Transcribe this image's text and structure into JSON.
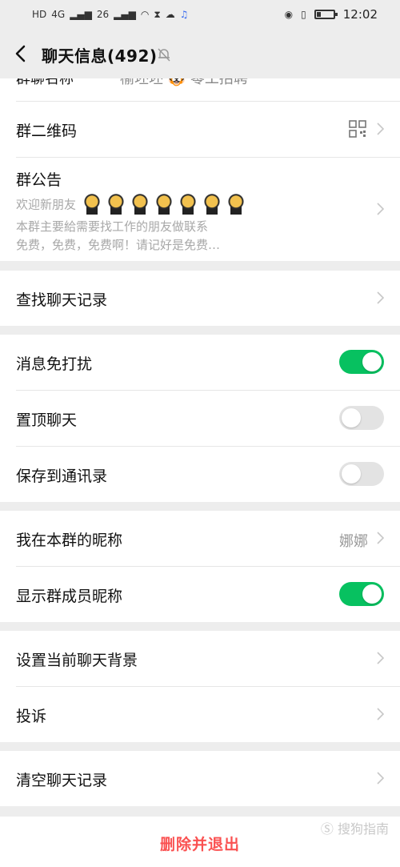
{
  "status_bar": {
    "left_items": [
      "HD",
      "4G",
      "26",
      "wifi",
      "sync",
      "cloud",
      "music"
    ],
    "time": "12:02",
    "battery_level": 0.3
  },
  "nav": {
    "title": "聊天信息(492)"
  },
  "peek": {
    "label": "群聊名称",
    "value": "榆坯坯 🐯 零工招聘"
  },
  "rows": {
    "qrcode": "群二维码",
    "notice_title": "群公告",
    "notice_line1": "欢迎新朋友",
    "notice_line2": "本群主要給需要找工作的朋友做联系",
    "notice_line3": "免费，免费，免费啊！请记好是免费…",
    "search_history": "查找聊天记录",
    "mute": "消息免打扰",
    "pin": "置顶聊天",
    "save_contacts": "保存到通讯录",
    "my_nickname": "我在本群的昵称",
    "my_nickname_value": "娜娜",
    "show_nicknames": "显示群成员昵称",
    "set_background": "设置当前聊天背景",
    "complain": "投诉",
    "clear_history": "清空聊天记录"
  },
  "toggles": {
    "mute": true,
    "pin": false,
    "save_contacts": false,
    "show_nicknames": true
  },
  "footer": {
    "delete_exit": "删除并退出",
    "watermark": "Ⓢ 搜狗指南"
  },
  "colors": {
    "accent_green": "#07c160",
    "danger_red": "#fa5151",
    "background": "#ededed"
  }
}
